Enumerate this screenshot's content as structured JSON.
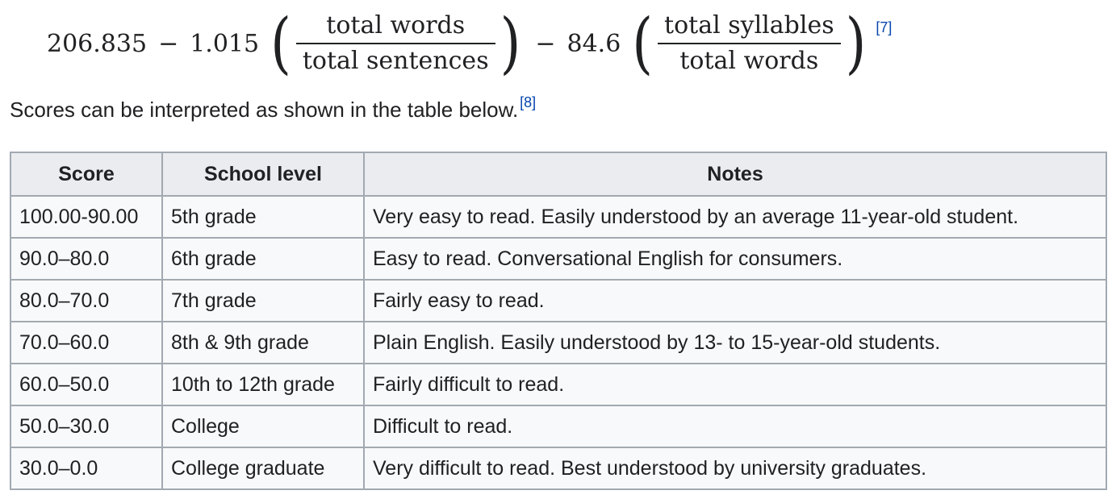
{
  "formula": {
    "constant": "206.835",
    "minus": "−",
    "coef1": "1.015",
    "frac1_numerator": "total words",
    "frac1_denominator": "total sentences",
    "coef2": "84.6",
    "frac2_numerator": "total syllables",
    "frac2_denominator": "total words",
    "paren_open": "(",
    "paren_close": ")",
    "ref": "[7]"
  },
  "intro": {
    "text": "Scores can be interpreted as shown in the table below.",
    "ref": "[8]"
  },
  "table": {
    "headers": [
      "Score",
      "School level",
      "Notes"
    ],
    "rows": [
      {
        "score": "100.00-90.00",
        "level": "5th grade",
        "notes": "Very easy to read. Easily understood by an average 11-year-old student."
      },
      {
        "score": "90.0–80.0",
        "level": "6th grade",
        "notes": "Easy to read. Conversational English for consumers."
      },
      {
        "score": "80.0–70.0",
        "level": "7th grade",
        "notes": "Fairly easy to read."
      },
      {
        "score": "70.0–60.0",
        "level": "8th & 9th grade",
        "notes": "Plain English. Easily understood by 13- to 15-year-old students."
      },
      {
        "score": "60.0–50.0",
        "level": "10th to 12th grade",
        "notes": "Fairly difficult to read."
      },
      {
        "score": "50.0–30.0",
        "level": "College",
        "notes": "Difficult to read."
      },
      {
        "score": "30.0–0.0",
        "level": "College graduate",
        "notes": "Very difficult to read. Best understood by university graduates."
      }
    ]
  },
  "colors": {
    "link": "#0645ad",
    "text": "#202122",
    "table_border": "#a2a9b1",
    "header_bg": "#eaecf0",
    "cell_bg": "#f8f9fa"
  }
}
